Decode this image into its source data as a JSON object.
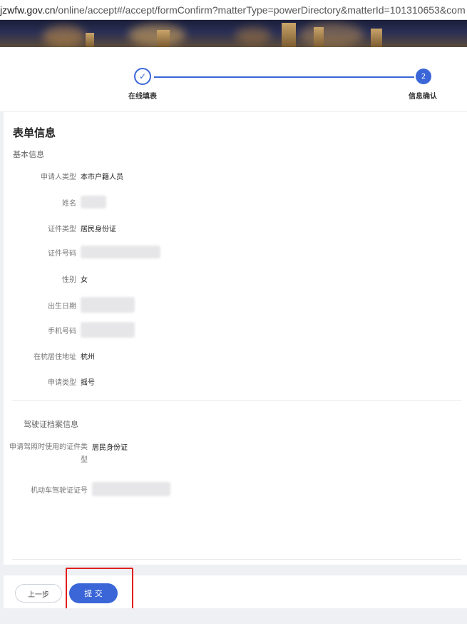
{
  "browser": {
    "url_host": "jzwfw.gov.cn",
    "url_path": "/online/accept#/accept/formConfirm?matterType=powerDirectory&matterId=101310653&com"
  },
  "steps": {
    "step1_label": "在线填表",
    "step1_icon": "✓",
    "step2_label": "信息确认",
    "step2_number": "2"
  },
  "form": {
    "title": "表单信息",
    "basic_section": "基本信息",
    "fields": {
      "applicant_type": {
        "label": "申请人类型",
        "value": "本市户籍人员"
      },
      "name": {
        "label": "姓名",
        "value": ""
      },
      "id_type": {
        "label": "证件类型",
        "value": "居民身份证"
      },
      "id_number": {
        "label": "证件号码",
        "value": ""
      },
      "gender": {
        "label": "性别",
        "value": "女"
      },
      "birth_date": {
        "label": "出生日期",
        "value": ""
      },
      "phone": {
        "label": "手机号码",
        "value": ""
      },
      "residence": {
        "label": "在杭居住地址",
        "value": "杭州"
      },
      "apply_type": {
        "label": "申请类型",
        "value": "摇号"
      }
    },
    "license_section": "驾驶证档案信息",
    "license_fields": {
      "license_id_type": {
        "label": "申请驾照时使用的证件类型",
        "value": "居民身份证"
      },
      "license_number": {
        "label": "机动车驾驶证证号",
        "value": ""
      }
    }
  },
  "footer": {
    "prev_label": "上一步",
    "submit_label": "提 交"
  },
  "colors": {
    "primary": "#3a66d8",
    "highlight": "#e0201d"
  }
}
